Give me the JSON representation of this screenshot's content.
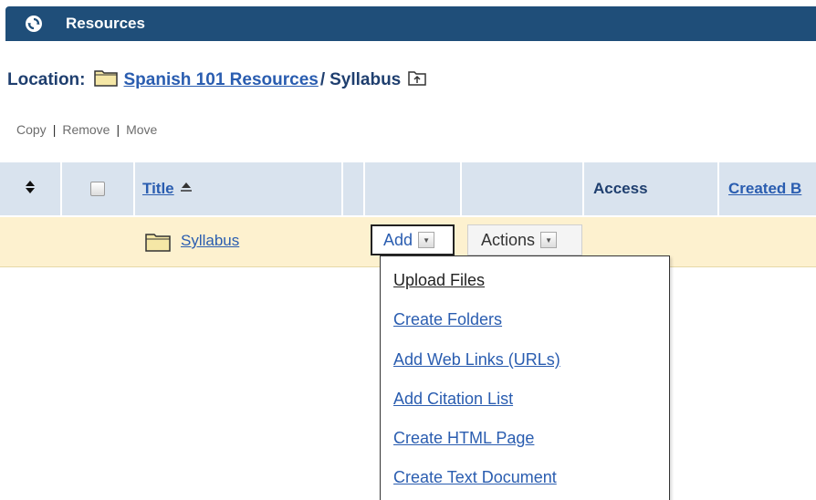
{
  "header": {
    "title": "Resources",
    "icon": "refresh-circle-icon"
  },
  "location": {
    "label": "Location:",
    "path_link": "Spanish 101 Resources ",
    "separator": "/",
    "current": "Syllabus",
    "up_icon": "folder-up-icon"
  },
  "toolbar": {
    "copy": "Copy",
    "remove": "Remove",
    "move": "Move",
    "separator": "|"
  },
  "table": {
    "sort_icon": "sort-arrows-icon",
    "columns": {
      "title": "Title",
      "access": "Access",
      "created_by": "Created B"
    },
    "rows": [
      {
        "name": "Syllabus",
        "add_label": "Add",
        "actions_label": "Actions"
      }
    ]
  },
  "add_menu": {
    "items": [
      "Upload Files",
      "Create Folders",
      "Add Web Links (URLs)",
      "Add Citation List",
      "Create HTML Page",
      "Create Text Document"
    ]
  },
  "colors": {
    "header_bg": "#1f4e79",
    "table_header_bg": "#d9e3ee",
    "selected_row_bg": "#fdf1cf",
    "link": "#2a5db0"
  }
}
